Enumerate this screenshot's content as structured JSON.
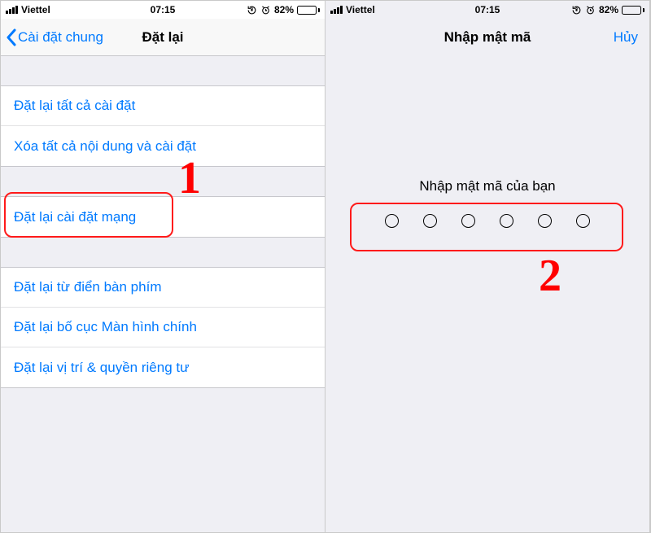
{
  "status": {
    "carrier": "Viettel",
    "time": "07:15",
    "battery_pct": "82%"
  },
  "left": {
    "nav_back": "Cài đặt chung",
    "nav_title": "Đặt lại",
    "items_a": [
      "Đặt lại tất cả cài đặt",
      "Xóa tất cả nội dung và cài đặt"
    ],
    "items_b": [
      "Đặt lại cài đặt mạng"
    ],
    "items_c": [
      "Đặt lại từ điển bàn phím",
      "Đặt lại bố cục Màn hình chính",
      "Đặt lại vị trí & quyền riêng tư"
    ],
    "annotation_number": "1"
  },
  "right": {
    "nav_title": "Nhập mật mã",
    "nav_action": "Hủy",
    "prompt": "Nhập mật mã của bạn",
    "annotation_number": "2"
  }
}
